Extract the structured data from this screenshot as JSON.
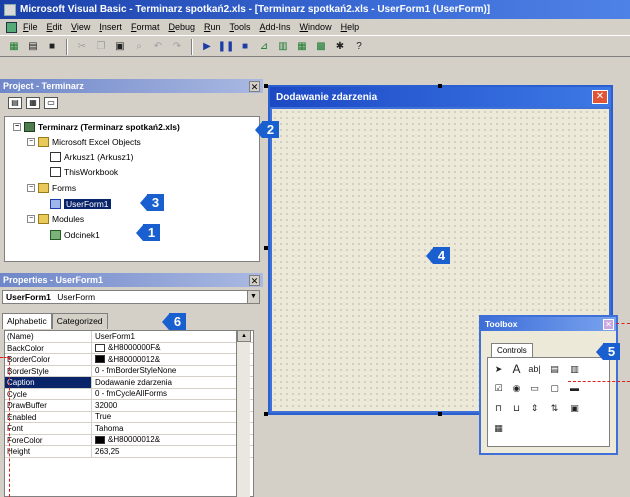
{
  "window": {
    "title": "Microsoft Visual Basic - Terminarz spotkań2.xls - [Terminarz spotkań2.xls - UserForm1 (UserForm)]"
  },
  "menu": [
    "File",
    "Edit",
    "View",
    "Insert",
    "Format",
    "Debug",
    "Run",
    "Tools",
    "Add-Ins",
    "Window",
    "Help"
  ],
  "project": {
    "title": "Project - Terminarz",
    "root": "Terminarz (Terminarz spotkań2.xls)",
    "excel_objects": "Microsoft Excel Objects",
    "sheet1": "Arkusz1 (Arkusz1)",
    "workbook": "ThisWorkbook",
    "forms": "Forms",
    "userform": "UserForm1",
    "modules": "Modules",
    "module1": "Odcinek1"
  },
  "properties": {
    "title": "Properties - UserForm1",
    "object_name": "UserForm1",
    "object_type": "UserForm",
    "tabs": [
      "Alphabetic",
      "Categorized"
    ],
    "rows": [
      {
        "name": "(Name)",
        "value": "UserForm1"
      },
      {
        "name": "BackColor",
        "value": "&H8000000F&",
        "swatch": "#ffffff"
      },
      {
        "name": "BorderColor",
        "value": "&H80000012&",
        "swatch": "#000000"
      },
      {
        "name": "BorderStyle",
        "value": "0 - fmBorderStyleNone"
      },
      {
        "name": "Caption",
        "value": "Dodawanie zdarzenia"
      },
      {
        "name": "Cycle",
        "value": "0 - fmCycleAllForms"
      },
      {
        "name": "DrawBuffer",
        "value": "32000"
      },
      {
        "name": "Enabled",
        "value": "True"
      },
      {
        "name": "Font",
        "value": "Tahoma"
      },
      {
        "name": "ForeColor",
        "value": "&H80000012&",
        "swatch": "#000000"
      },
      {
        "name": "Height",
        "value": "263,25"
      }
    ]
  },
  "userform": {
    "caption": "Dodawanie zdarzenia"
  },
  "toolbox": {
    "title": "Toolbox",
    "tab": "Controls"
  },
  "callouts": [
    "1",
    "2",
    "3",
    "4",
    "5",
    "6"
  ],
  "colors": {
    "accent": "#1a5fd0",
    "selection": "#0a246a",
    "xp_blue": "#3e70d8"
  }
}
